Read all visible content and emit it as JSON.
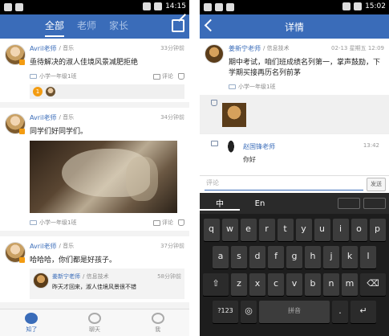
{
  "left": {
    "status_time": "14:15",
    "tabs": [
      "全部",
      "老师",
      "家长"
    ],
    "posts": [
      {
        "author": "Avril老师",
        "subject": "/ 音乐",
        "time": "33分钟前",
        "text": "亟待解决的淑人佳境风景减肥拒绝",
        "class": "小学一年级1班",
        "comment": "评论",
        "like_count": "1"
      },
      {
        "author": "Avril老师",
        "subject": "/ 音乐",
        "time": "34分钟前",
        "text": "同学们好同学们。",
        "class": "小学一年级1班",
        "comment": "评论"
      },
      {
        "author": "Avril老师",
        "subject": "/ 音乐",
        "time": "37分钟前",
        "text": "哈哈哈，你们都是好孩子。",
        "quote": {
          "author": "姜新宁老师",
          "subject": "/ 信息技术",
          "time": "58分钟前",
          "text": "昨天才回来，淑人佳境风景很不错"
        }
      }
    ],
    "nav": [
      "知了",
      "聊天",
      "我"
    ]
  },
  "right": {
    "status_time": "15:02",
    "title": "详情",
    "post": {
      "author": "姜新宁老师",
      "subject": "/ 信息技术",
      "time": "02-13 星期五 12:09",
      "text": "期中考试，咱们班成绩名列第一，掌声鼓励，下学期买接再历名列前茅",
      "class": "小学一年级1班"
    },
    "comment": {
      "author": "赵国锋老师",
      "time": "13:42",
      "text": "你好"
    },
    "input_placeholder": "评论",
    "send": "发送",
    "keyboard": {
      "langs": [
        "中",
        "En"
      ],
      "row1": [
        "q",
        "w",
        "e",
        "r",
        "t",
        "y",
        "u",
        "i",
        "o",
        "p"
      ],
      "row2": [
        "a",
        "s",
        "d",
        "f",
        "g",
        "h",
        "j",
        "k",
        "l"
      ],
      "row3": [
        "z",
        "x",
        "c",
        "v",
        "b",
        "n",
        "m"
      ],
      "row4_left": "?123",
      "space": "拼音"
    }
  }
}
